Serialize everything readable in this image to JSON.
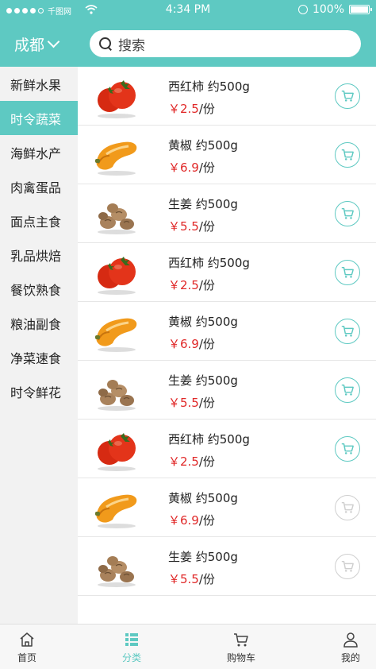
{
  "status_bar": {
    "carrier": "千图网",
    "time": "4:34 PM",
    "battery": "100%"
  },
  "header": {
    "city": "成都",
    "search_placeholder": "搜索"
  },
  "sidebar": {
    "items": [
      {
        "label": "新鲜水果",
        "active": false
      },
      {
        "label": "时令蔬菜",
        "active": true
      },
      {
        "label": "海鲜水产",
        "active": false
      },
      {
        "label": "肉禽蛋品",
        "active": false
      },
      {
        "label": "面点主食",
        "active": false
      },
      {
        "label": "乳品烘焙",
        "active": false
      },
      {
        "label": "餐饮熟食",
        "active": false
      },
      {
        "label": "粮油副食",
        "active": false
      },
      {
        "label": "净菜速食",
        "active": false
      },
      {
        "label": "时令鲜花",
        "active": false
      }
    ]
  },
  "products": [
    {
      "name": "西红柿 约500g",
      "price": "￥2.5",
      "unit": "/份",
      "image": "tomato",
      "cart_enabled": true
    },
    {
      "name": "黄椒 约500g",
      "price": "￥6.9",
      "unit": "/份",
      "image": "yellow-pepper",
      "cart_enabled": true
    },
    {
      "name": "生姜 约500g",
      "price": "￥5.5",
      "unit": "/份",
      "image": "ginger",
      "cart_enabled": true
    },
    {
      "name": "西红柿 约500g",
      "price": "￥2.5",
      "unit": "/份",
      "image": "tomato",
      "cart_enabled": true
    },
    {
      "name": "黄椒 约500g",
      "price": "￥6.9",
      "unit": "/份",
      "image": "yellow-pepper",
      "cart_enabled": true
    },
    {
      "name": "生姜 约500g",
      "price": "￥5.5",
      "unit": "/份",
      "image": "ginger",
      "cart_enabled": true
    },
    {
      "name": "西红柿 约500g",
      "price": "￥2.5",
      "unit": "/份",
      "image": "tomato",
      "cart_enabled": true
    },
    {
      "name": "黄椒 约500g",
      "price": "￥6.9",
      "unit": "/份",
      "image": "yellow-pepper",
      "cart_enabled": false
    },
    {
      "name": "生姜 约500g",
      "price": "￥5.5",
      "unit": "/份",
      "image": "ginger",
      "cart_enabled": false
    }
  ],
  "tabbar": {
    "tabs": [
      {
        "label": "首页",
        "icon": "home-icon",
        "active": false
      },
      {
        "label": "分类",
        "icon": "category-icon",
        "active": true
      },
      {
        "label": "购物车",
        "icon": "cart-icon",
        "active": false
      },
      {
        "label": "我的",
        "icon": "user-icon",
        "active": false
      }
    ]
  },
  "colors": {
    "accent": "#5ec9c2",
    "price": "#e02828",
    "disabled": "#cfcfcf"
  }
}
